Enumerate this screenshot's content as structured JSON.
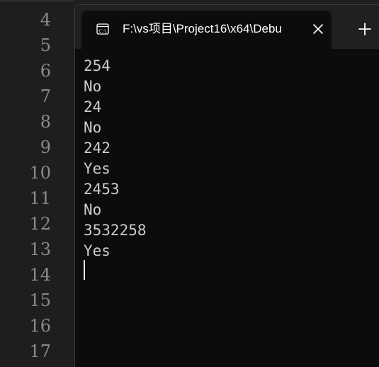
{
  "editor": {
    "line_numbers": [
      "4",
      "5",
      "6",
      "7",
      "8",
      "9",
      "10",
      "11",
      "12",
      "13",
      "14",
      "15",
      "16",
      "17"
    ]
  },
  "terminal": {
    "tab": {
      "icon": "terminal-icon",
      "title": "F:\\vs项目\\Project16\\x64\\Debu",
      "close_icon": "close-icon"
    },
    "new_tab_icon": "plus-icon",
    "output_lines": [
      "254",
      "No",
      "24",
      "No",
      "242",
      "Yes",
      "2453",
      "No",
      "3532258",
      "Yes"
    ]
  },
  "colors": {
    "editor_bg": "#1e1e1e",
    "terminal_bg": "#0c0c0c",
    "tabbar_bg": "#202020",
    "text": "#cccccc",
    "line_number": "#8a8a8a"
  }
}
